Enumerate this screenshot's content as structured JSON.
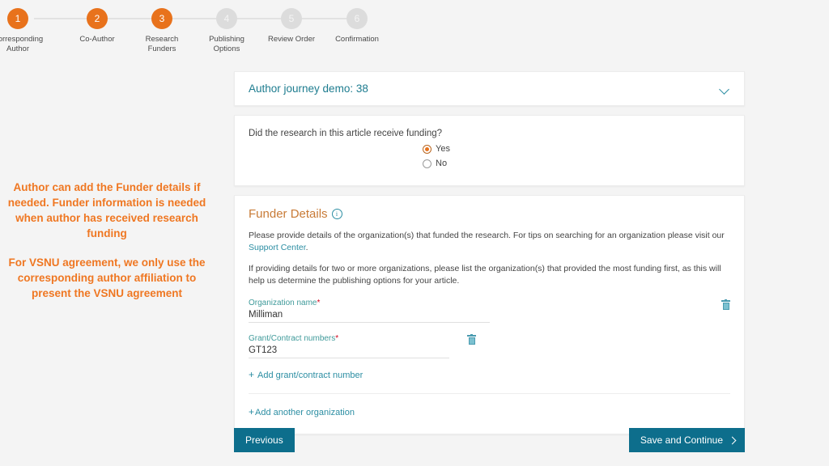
{
  "stepper": {
    "steps": [
      {
        "number": "1",
        "label": "Corresponding\nAuthor",
        "state": "active"
      },
      {
        "number": "2",
        "label": "Co-Author",
        "state": "active"
      },
      {
        "number": "3",
        "label": "Research\nFunders",
        "state": "active"
      },
      {
        "number": "4",
        "label": "Publishing\nOptions",
        "state": "inactive"
      },
      {
        "number": "5",
        "label": "Review Order",
        "state": "inactive"
      },
      {
        "number": "6",
        "label": "Confirmation",
        "state": "inactive"
      }
    ]
  },
  "annotation": {
    "paragraph1": "Author can add the Funder details if needed. Funder information is needed when author has received research funding",
    "paragraph2": "For VSNU agreement, we only use the corresponding author affiliation to present the VSNU agreement",
    "color": "#ef7722"
  },
  "journey": {
    "title": "Author journey demo: 38",
    "chevron": "chevron-down-icon"
  },
  "funding": {
    "question": "Did the research in this article receive funding?",
    "options": [
      {
        "label": "Yes",
        "selected": true
      },
      {
        "label": "No",
        "selected": false
      }
    ]
  },
  "funder_details": {
    "heading": "Funder Details",
    "info_icon": "info-icon",
    "paragraph1_before_link": "Please provide details of the organization(s) that funded the research. For tips on searching for an organization please visit our ",
    "paragraph1_link": "Support Center",
    "paragraph1_after_link": ".",
    "paragraph2": "If providing details for two or more organizations, please list the organization(s) that provided the most funding first, as this will help us determine the publishing options for your article.",
    "organization_field": {
      "label": "Organization name",
      "required_marker": "*",
      "value": "Milliman",
      "delete_icon": "trash-icon"
    },
    "grant_field": {
      "label": "Grant/Contract numbers",
      "required_marker": "*",
      "value": "GT123",
      "delete_icon": "trash-icon"
    },
    "add_grant_label": "Add grant/contract number",
    "add_grant_plus": "+",
    "add_organization_label": "Add another organization",
    "add_organization_plus": "+"
  },
  "footer": {
    "previous_label": "Previous",
    "next_label": "Save and Continue",
    "button_color": "#0d6e8c"
  }
}
